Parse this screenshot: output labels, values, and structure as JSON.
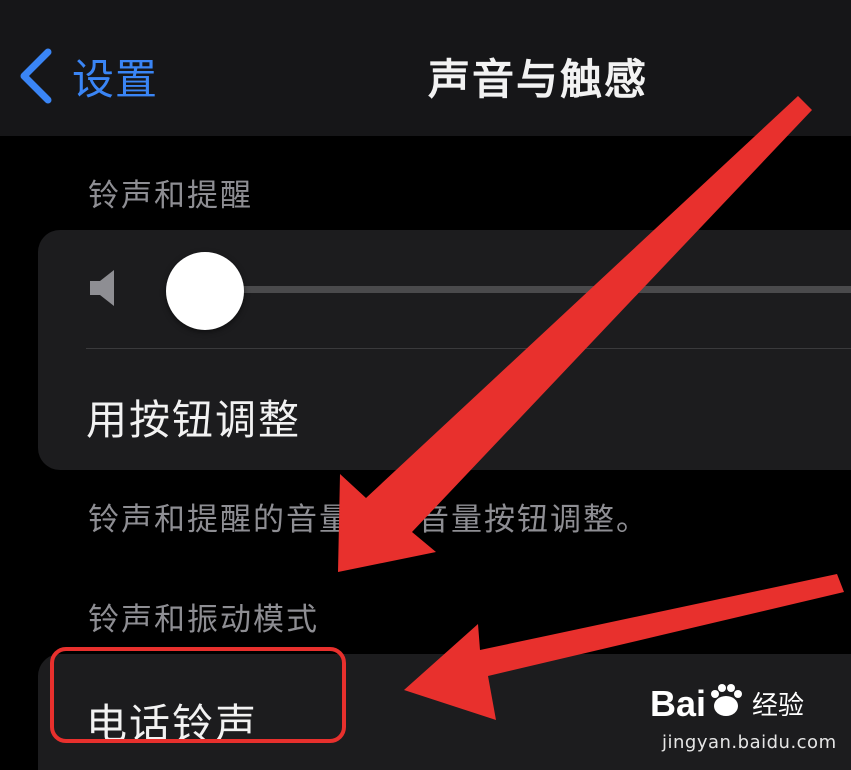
{
  "navbar": {
    "back_label": "设置",
    "title": "声音与触感"
  },
  "ringer_section": {
    "header": "铃声和提醒",
    "volume_level": 0.05,
    "adjust_with_buttons_label": "用按钮调整",
    "footer": "铃声和提醒的音量可用音量按钮调整。"
  },
  "modes_section": {
    "header": "铃声和振动模式",
    "ringtone_label": "电话铃声"
  },
  "watermark": {
    "logo_text": "Bai 经验",
    "url": "jingyan.baidu.com"
  },
  "colors": {
    "accent": "#3a85f5",
    "annotation_red": "#e8302d",
    "background": "#000000",
    "card": "#1c1c1e"
  }
}
